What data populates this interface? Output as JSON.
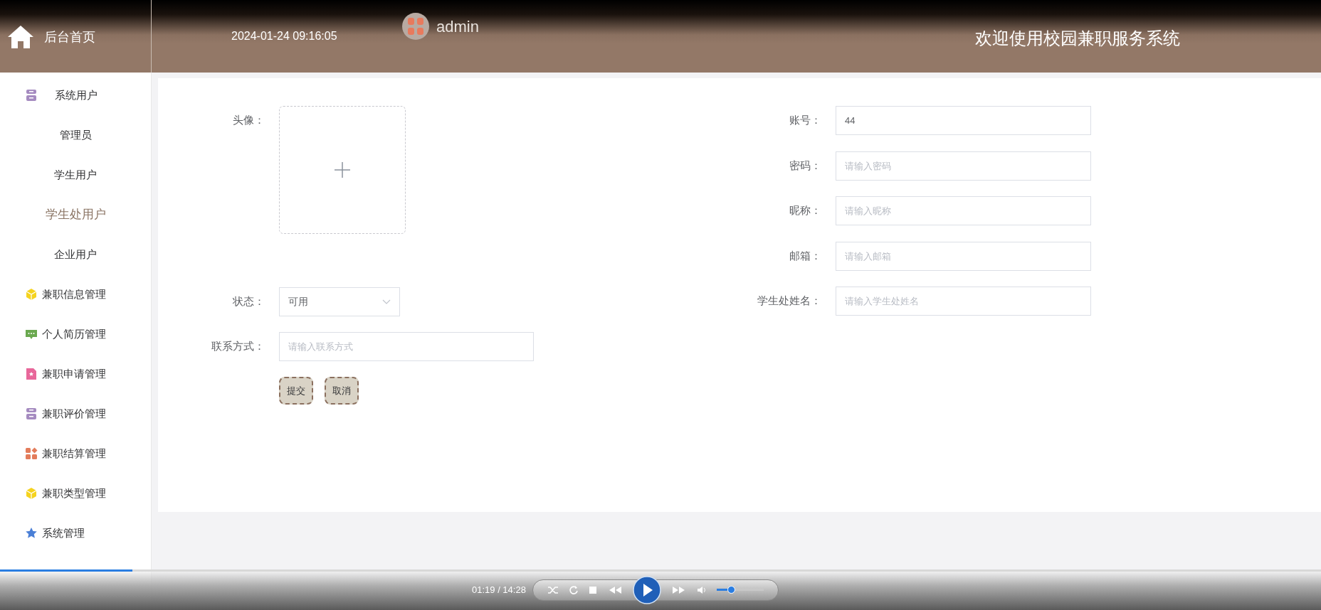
{
  "header": {
    "home_label": "后台首页",
    "datetime": "2024-01-24 09:16:05",
    "username": "admin",
    "title": "欢迎使用校园兼职服务系统"
  },
  "sidebar": {
    "items": [
      {
        "label": "系统用户",
        "selected": false,
        "children": [
          {
            "label": "管理员",
            "selected": false
          },
          {
            "label": "学生用户",
            "selected": false
          },
          {
            "label": "学生处用户",
            "selected": true
          },
          {
            "label": "企业用户",
            "selected": false
          }
        ]
      },
      {
        "label": "兼职信息管理",
        "selected": false
      },
      {
        "label": "个人简历管理",
        "selected": false
      },
      {
        "label": "兼职申请管理",
        "selected": false
      },
      {
        "label": "兼职评价管理",
        "selected": false
      },
      {
        "label": "兼职结算管理",
        "selected": false
      },
      {
        "label": "兼职类型管理",
        "selected": false
      },
      {
        "label": "系统管理",
        "selected": false
      }
    ]
  },
  "form": {
    "left": [
      {
        "kind": "upload",
        "label": "头像："
      },
      {
        "kind": "select",
        "label": "状态：",
        "value": "可用"
      },
      {
        "kind": "text",
        "label": "联系方式：",
        "placeholder": "请输入联系方式"
      }
    ],
    "right": [
      {
        "kind": "text",
        "label": "账号：",
        "value": "44"
      },
      {
        "kind": "text",
        "label": "密码：",
        "placeholder": "请输入密码"
      },
      {
        "kind": "text",
        "label": "昵称：",
        "placeholder": "请输入昵称"
      },
      {
        "kind": "text",
        "label": "邮箱：",
        "placeholder": "请输入邮箱"
      },
      {
        "kind": "text",
        "label": "学生处姓名：",
        "placeholder": "请输入学生处姓名"
      }
    ],
    "buttons": [
      "提交",
      "取消"
    ]
  },
  "player": {
    "progress": {
      "level": 0.1
    },
    "time": "01:19 / 14:28",
    "volume": {
      "level": 0.31
    }
  }
}
